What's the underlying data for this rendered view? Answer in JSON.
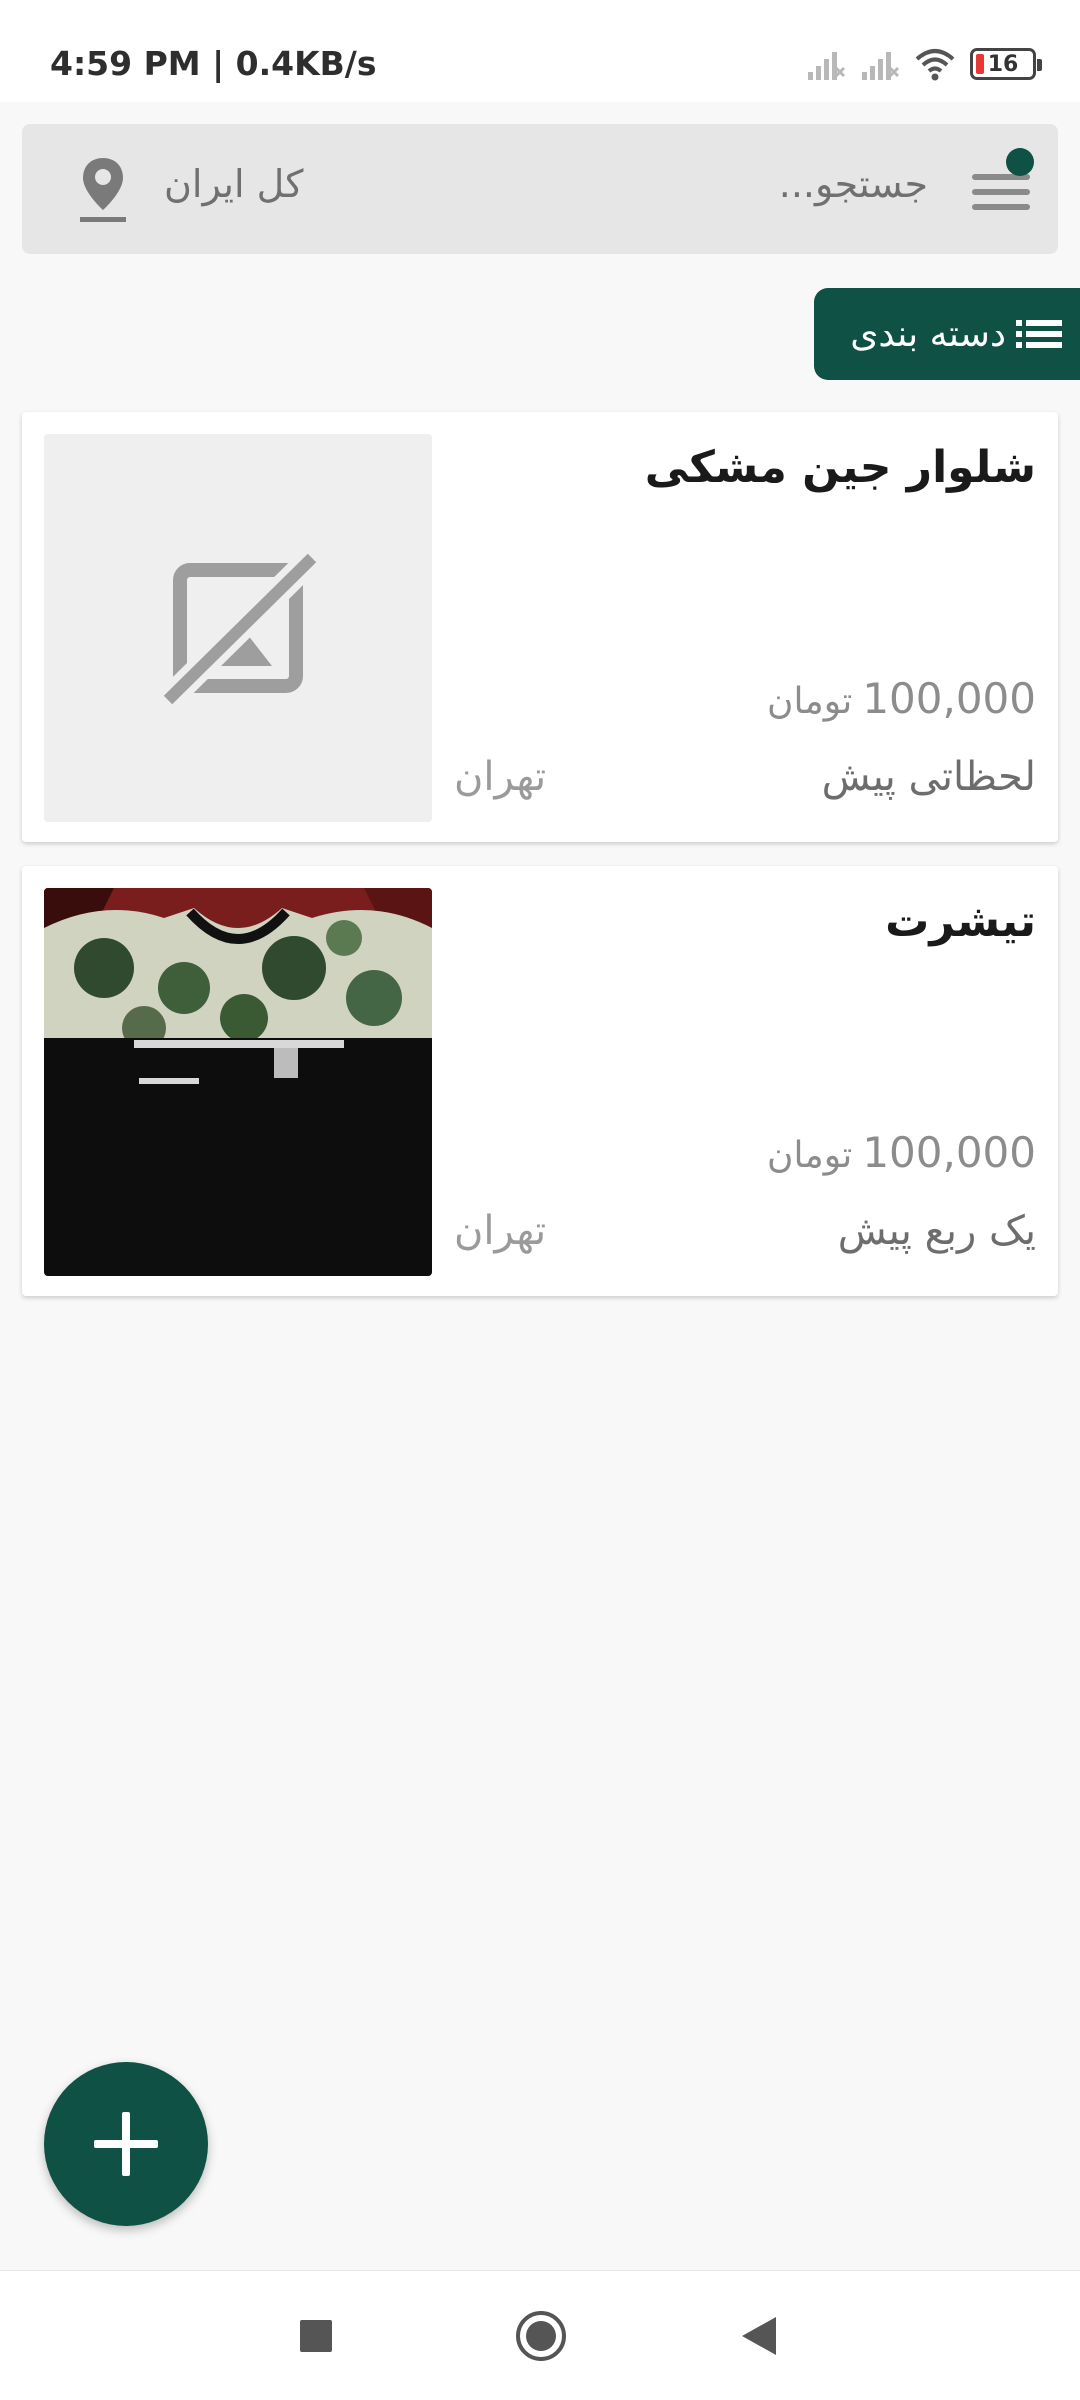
{
  "status_bar": {
    "time": "4:59 PM | 0.4KB/s",
    "battery": "16",
    "battery_color": "#e53935"
  },
  "search": {
    "placeholder": "جستجو...",
    "location": "کل ایران",
    "icons": [
      "menu-icon",
      "location-pin-icon"
    ]
  },
  "category_button": {
    "label": "دسته بندی",
    "icon": "list-icon"
  },
  "listings": [
    {
      "title": "شلوار جین مشکی",
      "price": "100,000",
      "currency": "تومان",
      "time": "لحظاتی پیش",
      "city": "تهران",
      "image": "no-image-icon"
    },
    {
      "title": "تیشرت",
      "price": "100,000",
      "currency": "تومان",
      "time": "یک ربع پیش",
      "city": "تهران",
      "image": "tshirt-photo"
    }
  ],
  "fab": {
    "icon": "plus-icon"
  },
  "colors": {
    "accent": "#0f5145",
    "background": "#f8f8f8",
    "search_background": "#e6e6e6"
  }
}
